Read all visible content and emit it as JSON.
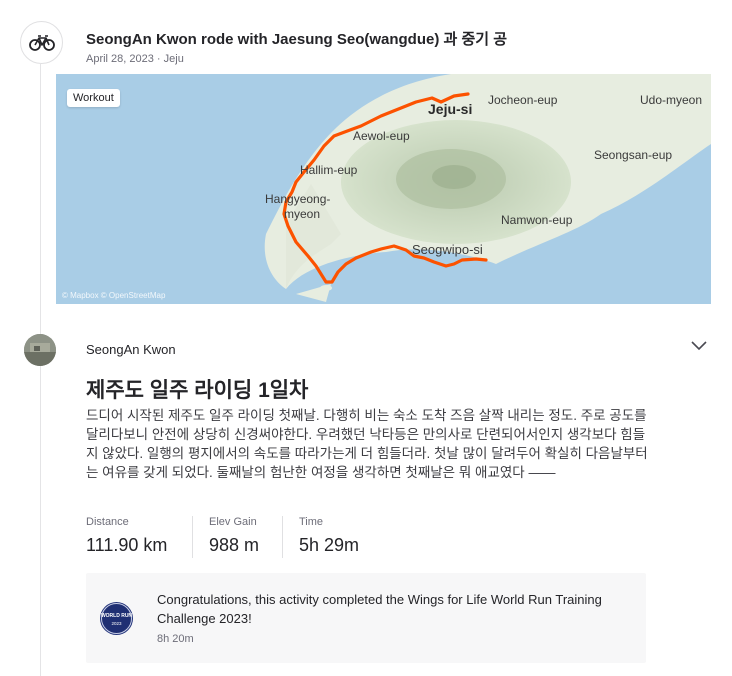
{
  "activity_header": {
    "title": "SeongAn Kwon rode with Jaesung Seo(wangdue) 과 중기 공",
    "meta": "April 28, 2023 · Jeju",
    "icon": "bicycle-icon"
  },
  "map": {
    "tag": "Workout",
    "attribution": "© Mapbox © OpenStreetMap",
    "place_labels": [
      "Jeju-si",
      "Jocheon-eup",
      "Udo-myeon",
      "Aewol-eup",
      "Hallim-eup",
      "Seongsan-eup",
      "Hangyeong-",
      "myeon",
      "Namwon-eup",
      "Seogwipo-si"
    ],
    "route_color": "#fc5200"
  },
  "post": {
    "author": "SeongAn Kwon",
    "title": "제주도 일주 라이딩 1일차",
    "description": "드디어 시작된 제주도 일주 라이딩 첫째날. 다행히 비는 숙소 도착 즈음 살짝 내리는 정도. 주로 공도를 달리다보니 안전에 상당히 신경써야한다. 우려했던 낙타등은 만의사로 단련되어서인지 생각보다 힘들지 않았다. 일행의 평지에서의 속도를 따라가는게 더 힘들더라. 첫날 많이 달려두어 확실히 다음날부터는 여유를 갖게 되었다. 둘째날의 험난한 여정을 생각하면 첫째날은 뭐 애교였다 ——"
  },
  "stats": [
    {
      "label": "Distance",
      "value": "111.90 km"
    },
    {
      "label": "Elev Gain",
      "value": "988 m"
    },
    {
      "label": "Time",
      "value": "5h 29m"
    }
  ],
  "challenge": {
    "text": "Congratulations, this activity completed the Wings for Life World Run Training Challenge 2023!",
    "time": "8h 20m",
    "badge_text": "WORLD RUN",
    "badge_year": "2023"
  }
}
